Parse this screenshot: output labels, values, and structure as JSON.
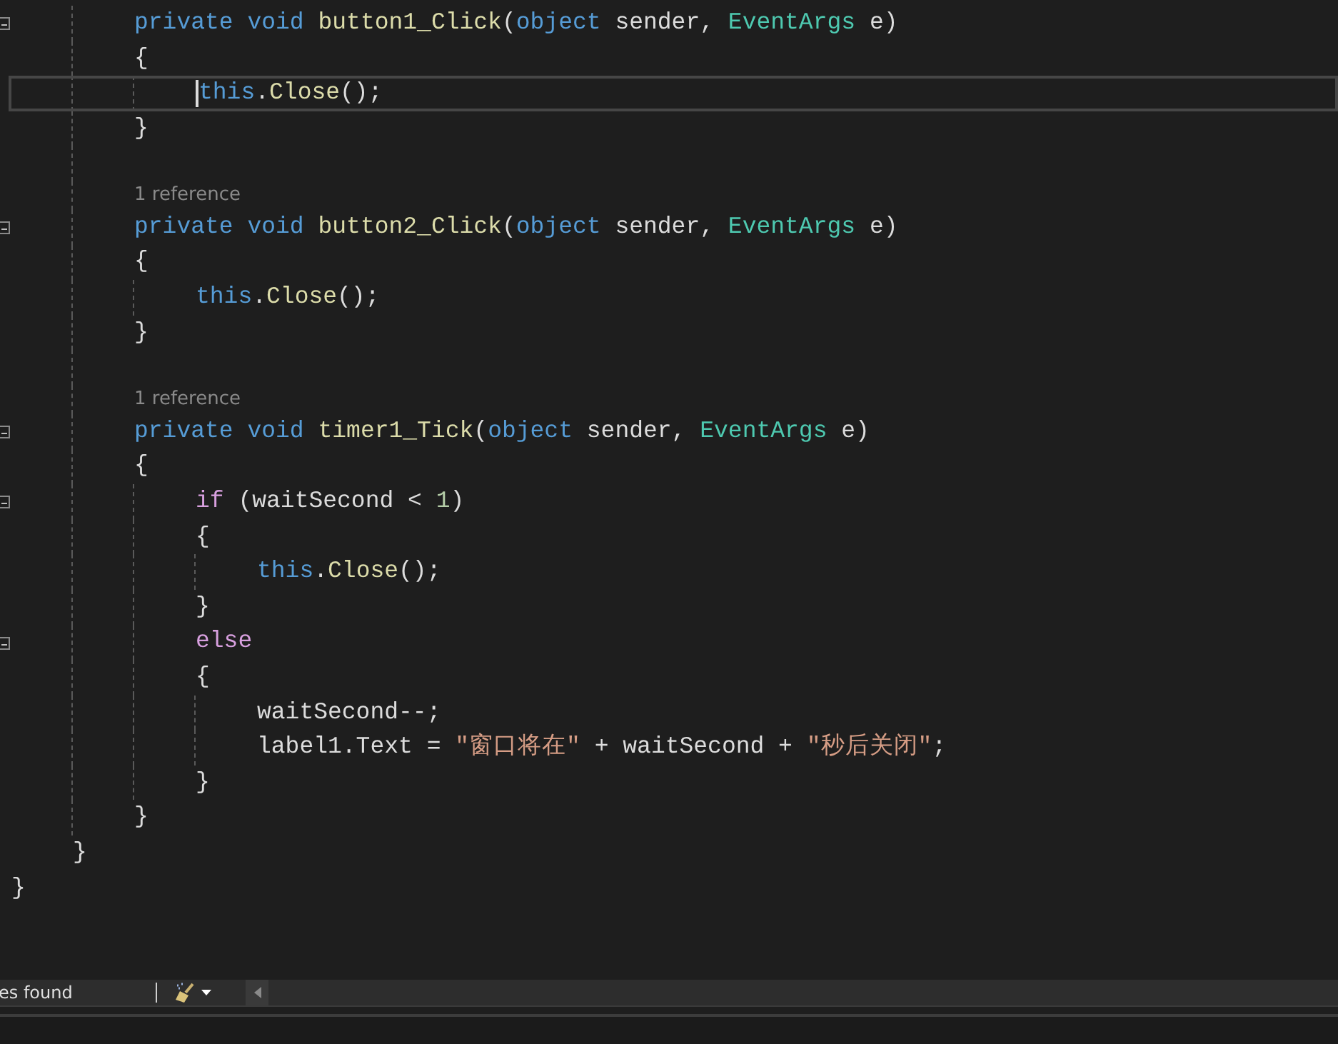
{
  "editor": {
    "lines": [
      {
        "kind": "block",
        "children": [
          {
            "kind": "block",
            "children": [
              {
                "kind": "code",
                "foldable": true,
                "tokens": [
                  {
                    "kind": "keyword",
                    "text": "private "
                  },
                  {
                    "kind": "keyword",
                    "text": "void "
                  },
                  {
                    "kind": "method",
                    "text": "button1_Click"
                  },
                  {
                    "kind": "plain",
                    "text": "("
                  },
                  {
                    "kind": "keyword",
                    "text": "object"
                  },
                  {
                    "kind": "plain",
                    "text": " sender, "
                  },
                  {
                    "kind": "type",
                    "text": "EventArgs"
                  },
                  {
                    "kind": "plain",
                    "text": " e)"
                  }
                ]
              },
              {
                "kind": "code",
                "tokens": [
                  {
                    "kind": "plain",
                    "text": "{"
                  }
                ]
              },
              {
                "kind": "block",
                "children": [
                  {
                    "kind": "code",
                    "current": true,
                    "tokens": [
                      {
                        "kind": "keyword",
                        "text": "this"
                      },
                      {
                        "kind": "plain",
                        "text": "."
                      },
                      {
                        "kind": "method",
                        "text": "Close"
                      },
                      {
                        "kind": "plain",
                        "text": "();"
                      }
                    ]
                  }
                ]
              },
              {
                "kind": "code",
                "tokens": [
                  {
                    "kind": "plain",
                    "text": "}"
                  }
                ]
              },
              {
                "kind": "blank"
              },
              {
                "kind": "lens",
                "text": "1 reference"
              },
              {
                "kind": "code",
                "foldable": true,
                "tokens": [
                  {
                    "kind": "keyword",
                    "text": "private "
                  },
                  {
                    "kind": "keyword",
                    "text": "void "
                  },
                  {
                    "kind": "method",
                    "text": "button2_Click"
                  },
                  {
                    "kind": "plain",
                    "text": "("
                  },
                  {
                    "kind": "keyword",
                    "text": "object"
                  },
                  {
                    "kind": "plain",
                    "text": " sender, "
                  },
                  {
                    "kind": "type",
                    "text": "EventArgs"
                  },
                  {
                    "kind": "plain",
                    "text": " e)"
                  }
                ]
              },
              {
                "kind": "code",
                "tokens": [
                  {
                    "kind": "plain",
                    "text": "{"
                  }
                ]
              },
              {
                "kind": "block",
                "children": [
                  {
                    "kind": "code",
                    "tokens": [
                      {
                        "kind": "keyword",
                        "text": "this"
                      },
                      {
                        "kind": "plain",
                        "text": "."
                      },
                      {
                        "kind": "method",
                        "text": "Close"
                      },
                      {
                        "kind": "plain",
                        "text": "();"
                      }
                    ]
                  }
                ]
              },
              {
                "kind": "code",
                "tokens": [
                  {
                    "kind": "plain",
                    "text": "}"
                  }
                ]
              },
              {
                "kind": "blank"
              },
              {
                "kind": "lens",
                "text": "1 reference"
              },
              {
                "kind": "code",
                "foldable": true,
                "tokens": [
                  {
                    "kind": "keyword",
                    "text": "private "
                  },
                  {
                    "kind": "keyword",
                    "text": "void "
                  },
                  {
                    "kind": "method",
                    "text": "timer1_Tick"
                  },
                  {
                    "kind": "plain",
                    "text": "("
                  },
                  {
                    "kind": "keyword",
                    "text": "object"
                  },
                  {
                    "kind": "plain",
                    "text": " sender, "
                  },
                  {
                    "kind": "type",
                    "text": "EventArgs"
                  },
                  {
                    "kind": "plain",
                    "text": " e)"
                  }
                ]
              },
              {
                "kind": "code",
                "tokens": [
                  {
                    "kind": "plain",
                    "text": "{"
                  }
                ]
              },
              {
                "kind": "block",
                "children": [
                  {
                    "kind": "code",
                    "foldable": true,
                    "tokens": [
                      {
                        "kind": "control",
                        "text": "if"
                      },
                      {
                        "kind": "plain",
                        "text": " (waitSecond < "
                      },
                      {
                        "kind": "number",
                        "text": "1"
                      },
                      {
                        "kind": "plain",
                        "text": ")"
                      }
                    ]
                  },
                  {
                    "kind": "code",
                    "tokens": [
                      {
                        "kind": "plain",
                        "text": "{"
                      }
                    ]
                  },
                  {
                    "kind": "block",
                    "children": [
                      {
                        "kind": "code",
                        "tokens": [
                          {
                            "kind": "keyword",
                            "text": "this"
                          },
                          {
                            "kind": "plain",
                            "text": "."
                          },
                          {
                            "kind": "method",
                            "text": "Close"
                          },
                          {
                            "kind": "plain",
                            "text": "();"
                          }
                        ]
                      }
                    ]
                  },
                  {
                    "kind": "code",
                    "tokens": [
                      {
                        "kind": "plain",
                        "text": "}"
                      }
                    ]
                  },
                  {
                    "kind": "code",
                    "foldable": true,
                    "tokens": [
                      {
                        "kind": "control",
                        "text": "else"
                      }
                    ]
                  },
                  {
                    "kind": "code",
                    "tokens": [
                      {
                        "kind": "plain",
                        "text": "{"
                      }
                    ]
                  },
                  {
                    "kind": "block",
                    "children": [
                      {
                        "kind": "code",
                        "tokens": [
                          {
                            "kind": "plain",
                            "text": "waitSecond--;"
                          }
                        ]
                      },
                      {
                        "kind": "code",
                        "tokens": [
                          {
                            "kind": "plain",
                            "text": "label1.Text = "
                          },
                          {
                            "kind": "string",
                            "text": "\"窗口将在\""
                          },
                          {
                            "kind": "plain",
                            "text": " + waitSecond + "
                          },
                          {
                            "kind": "string",
                            "text": "\"秒后关闭\""
                          },
                          {
                            "kind": "plain",
                            "text": ";"
                          }
                        ]
                      }
                    ]
                  },
                  {
                    "kind": "code",
                    "tokens": [
                      {
                        "kind": "plain",
                        "text": "}"
                      }
                    ]
                  }
                ]
              },
              {
                "kind": "code",
                "tokens": [
                  {
                    "kind": "plain",
                    "text": "}"
                  }
                ]
              }
            ]
          },
          {
            "kind": "code",
            "tokens": [
              {
                "kind": "plain",
                "text": "}"
              }
            ]
          }
        ]
      },
      {
        "kind": "code",
        "tokens": [
          {
            "kind": "plain",
            "text": "}"
          }
        ]
      }
    ]
  },
  "status_bar": {
    "issues_text": "es found"
  }
}
